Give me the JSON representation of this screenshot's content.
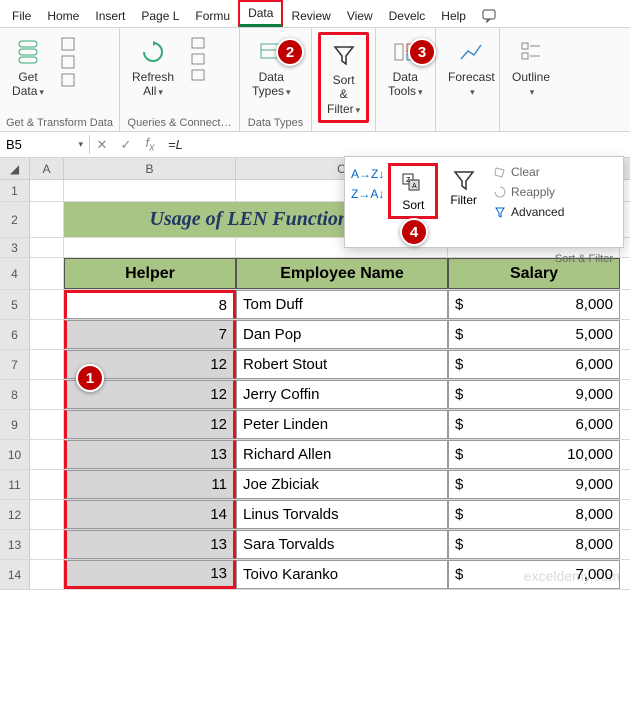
{
  "tabs": [
    "File",
    "Home",
    "Insert",
    "Page L",
    "Formu",
    "Data",
    "Review",
    "View",
    "Develc",
    "Help"
  ],
  "active_tab": "Data",
  "ribbon": {
    "groups": [
      {
        "label": "Get & Transform Data",
        "items": [
          {
            "label": "Get\nData"
          }
        ]
      },
      {
        "label": "Queries & Connect…",
        "items": [
          {
            "label": "Refresh\nAll"
          }
        ]
      },
      {
        "label": "Data Types",
        "items": [
          {
            "label": "Data\nTypes"
          }
        ]
      },
      {
        "label": "",
        "items": [
          {
            "label": "Sort &\nFilter",
            "hl": true
          }
        ]
      },
      {
        "label": "",
        "items": [
          {
            "label": "Data\nTools"
          }
        ]
      },
      {
        "label": "",
        "items": [
          {
            "label": "Forecast"
          }
        ]
      },
      {
        "label": "",
        "items": [
          {
            "label": "Outline"
          }
        ]
      }
    ]
  },
  "namebox": "B5",
  "formula": "=L",
  "sheet": {
    "banner": "Usage of LEN Function and a Helper Column",
    "headers": [
      "Helper",
      "Employee Name",
      "Salary"
    ],
    "rows": [
      {
        "helper": 8,
        "name": "Tom Duff",
        "salary": "8,000"
      },
      {
        "helper": 7,
        "name": "Dan Pop",
        "salary": "5,000"
      },
      {
        "helper": 12,
        "name": "Robert Stout",
        "salary": "6,000"
      },
      {
        "helper": 12,
        "name": "Jerry Coffin",
        "salary": "9,000"
      },
      {
        "helper": 12,
        "name": "Peter Linden",
        "salary": "6,000"
      },
      {
        "helper": 13,
        "name": "Richard Allen",
        "salary": "10,000"
      },
      {
        "helper": 11,
        "name": "Joe Zbiciak",
        "salary": "9,000"
      },
      {
        "helper": 14,
        "name": "Linus Torvalds",
        "salary": "8,000"
      },
      {
        "helper": 13,
        "name": "Sara Torvalds",
        "salary": "8,000"
      },
      {
        "helper": 13,
        "name": "Toivo Karanko",
        "salary": "7,000"
      }
    ]
  },
  "popup": {
    "sort": "Sort",
    "filter": "Filter",
    "clear": "Clear",
    "reapply": "Reapply",
    "advanced": "Advanced",
    "group_label": "Sort & Filter"
  },
  "annotations": {
    "c1": "1",
    "c2": "2",
    "c3": "3",
    "c4": "4"
  },
  "watermark": "exceldemy.com"
}
